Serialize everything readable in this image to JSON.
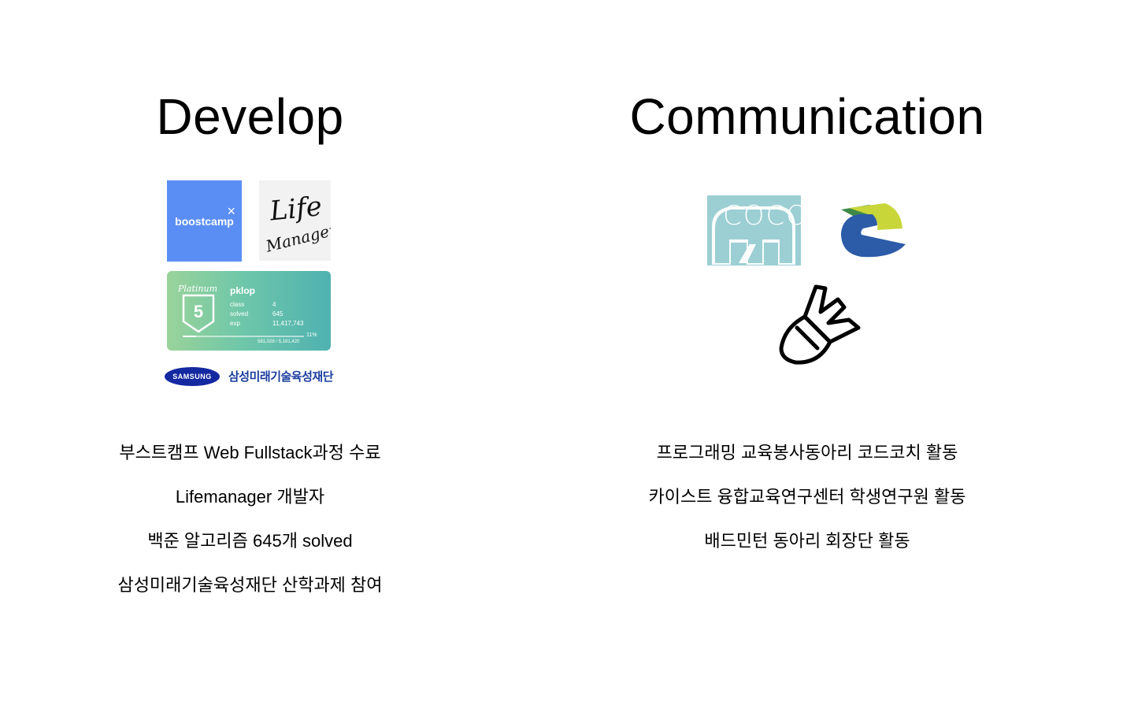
{
  "develop": {
    "title": "Develop",
    "logos": {
      "boostcamp": {
        "text": "boostcamp",
        "mark": "×",
        "color": "#5a8ef4"
      },
      "lifemanager": {
        "line1": "Life",
        "line2": "Manager"
      },
      "solved_badge": {
        "tier": "Platinum",
        "tier_number": "5",
        "handle": "pklop",
        "stats": [
          {
            "label": "class",
            "value": "4"
          },
          {
            "label": "solved",
            "value": "645"
          },
          {
            "label": "exp",
            "value": "11,417,743"
          }
        ],
        "progress_percent": "11%",
        "progress_fraction": 0.11,
        "progress_range": "581,028 / 5,181,420"
      },
      "samsung": {
        "brand": "SAMSUNG",
        "foundation": "삼성미래기술육성재단",
        "color": "#1428a0"
      }
    },
    "items": [
      "부스트캠프 Web Fullstack과정 수료",
      "Lifemanager 개발자",
      "백준 알고리즘 645개 solved",
      "삼성미래기술육성재단 산학과제 참여"
    ]
  },
  "communication": {
    "title": "Communication",
    "logos": {
      "coco": {
        "text": "COCO",
        "color": "#9bcfd3"
      },
      "kaist_icon": {
        "icon": "kaist-center-logo-icon",
        "colors": [
          "#2c5ba8",
          "#c8d63a"
        ]
      },
      "badminton": {
        "icon": "shuttlecock-icon"
      }
    },
    "items": [
      "프로그래밍 교육봉사동아리 코드코치 활동",
      "카이스트 융합교육연구센터 학생연구원 활동",
      "배드민턴 동아리 회장단 활동"
    ]
  }
}
